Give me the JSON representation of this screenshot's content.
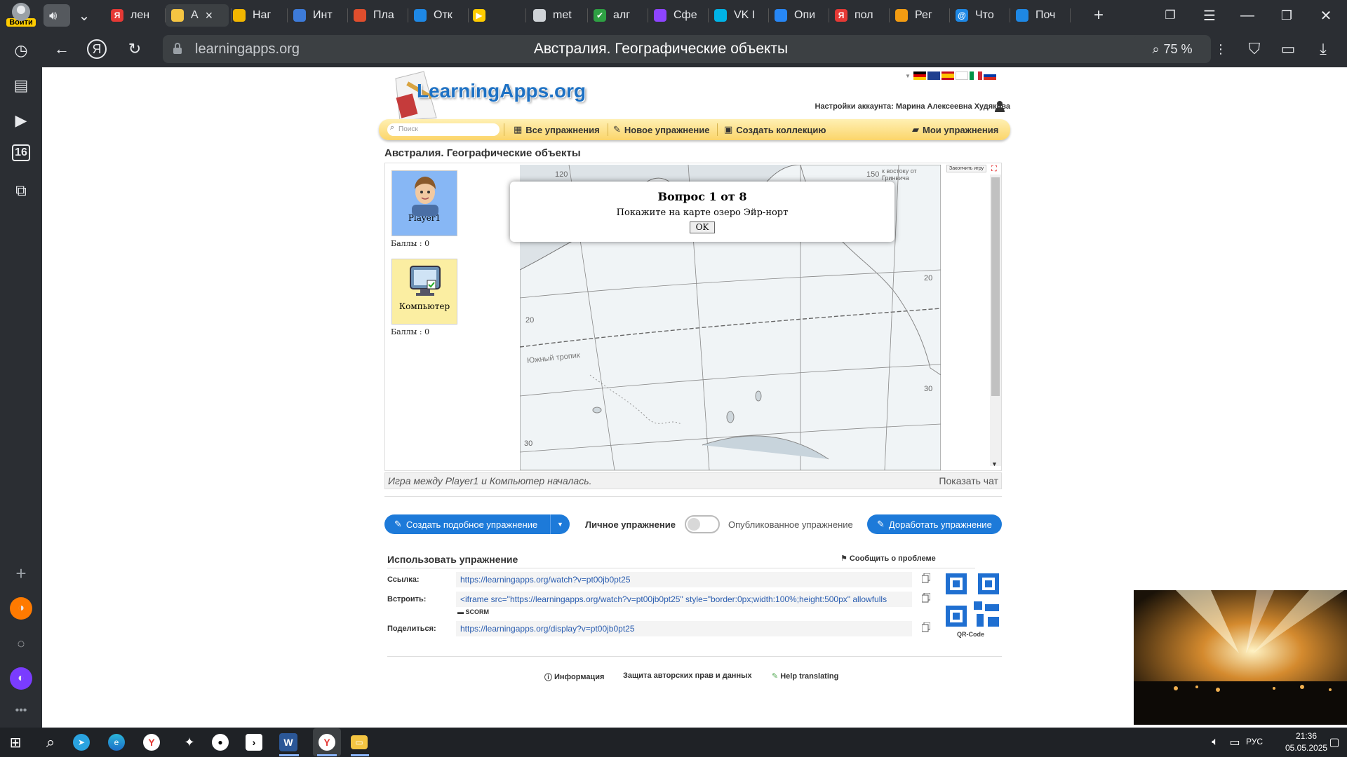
{
  "browser": {
    "login_label": "Войти",
    "tabs": [
      {
        "label": "лен",
        "color": "#e53935",
        "glyph": "Я"
      },
      {
        "label": "А",
        "color": "#f5c542",
        "glyph": "",
        "active": true
      },
      {
        "label": "Наг",
        "color": "#f2b600",
        "glyph": ""
      },
      {
        "label": "Инт",
        "color": "#3d7bd9",
        "glyph": ""
      },
      {
        "label": "Пла",
        "color": "#e04e2d",
        "glyph": ""
      },
      {
        "label": "Отк",
        "color": "#1e88e5",
        "glyph": ""
      },
      {
        "label": "",
        "color": "#ffcc00",
        "glyph": "▶"
      },
      {
        "label": "met",
        "color": "#cfd3d7",
        "glyph": ""
      },
      {
        "label": "алг",
        "color": "#2ea043",
        "glyph": "✔"
      },
      {
        "label": "Сфе",
        "color": "#8e44ff",
        "glyph": ""
      },
      {
        "label": "VK I",
        "color": "#00b3e6",
        "glyph": ""
      },
      {
        "label": "Опи",
        "color": "#2787f5",
        "glyph": ""
      },
      {
        "label": "пол",
        "color": "#e53935",
        "glyph": "Я"
      },
      {
        "label": "Рег",
        "color": "#f39c12",
        "glyph": ""
      },
      {
        "label": "Что",
        "color": "#1e88e5",
        "glyph": "@"
      },
      {
        "label": "Поч",
        "color": "#1e88e5",
        "glyph": ""
      }
    ],
    "url": "learningapps.org",
    "page_title": "Австралия. Географические объекты",
    "zoom": "75 %"
  },
  "site": {
    "logo_text": "LearningApps.org",
    "account": "Настройки аккаунта: Марина Алексеевна Худякова",
    "search_placeholder": "Поиск",
    "nav": {
      "all": "Все упражнения",
      "new": "Новое упражнение",
      "collection": "Создать коллекцию",
      "mine": "Мои упражнения"
    },
    "title": "Австралия. Географические объекты"
  },
  "game": {
    "end_game": "Закончить игру",
    "player1": {
      "name": "Player1",
      "score": "Баллы : 0"
    },
    "computer": {
      "name": "Компьютер",
      "score": "Баллы : 0"
    },
    "dialog": {
      "title": "Вопрос 1 от 8",
      "question": "Покажите на карте озеро Эйр-норт",
      "ok": "OK"
    },
    "map_labels": {
      "lon_120": "120",
      "lon_150": "150",
      "east_of": "к востоку от Гринвича",
      "tropic": "Южный тропик",
      "lat_20": "20",
      "lat_30": "30"
    },
    "chat_status": "Игра между Player1 и Компьютер началась.",
    "show_chat": "Показать чат"
  },
  "actions": {
    "create_similar": "Создать подобное упражнение",
    "personal": "Личное упражнение",
    "published": "Опубликованное упражнение",
    "improve": "Доработать упражнение"
  },
  "use": {
    "heading": "Использовать упражнение",
    "report": "Сообщить о проблеме",
    "link_label": "Ссылка:",
    "link_value": "https://learningapps.org/watch?v=pt00jb0pt25",
    "embed_label": "Встроить:",
    "embed_value": "<iframe src=\"https://learningapps.org/watch?v=pt00jb0pt25\" style=\"border:0px;width:100%;height:500px\" allowfulls",
    "scorm": "SCORM",
    "share_label": "Поделиться:",
    "share_value": "https://learningapps.org/display?v=pt00jb0pt25",
    "qr_label": "QR-Code"
  },
  "footer": {
    "info": "Информация",
    "copyright": "Защита авторских прав и данных",
    "translate": "Help translating"
  },
  "taskbar": {
    "lang": "РУС",
    "time": "21:36",
    "date": "05.05.2025"
  }
}
